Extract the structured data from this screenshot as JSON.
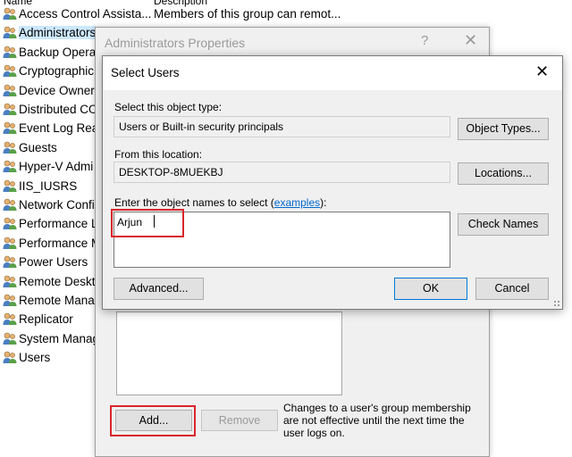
{
  "list": {
    "header_name": "Name",
    "header_desc": "Description",
    "groups": [
      {
        "name": "Access Control Assista...",
        "desc": "Members of this group can remot..."
      },
      {
        "name": "Administrators",
        "desc": ""
      },
      {
        "name": "Backup Operat",
        "desc": ""
      },
      {
        "name": "Cryptographic",
        "desc": ""
      },
      {
        "name": "Device Owners",
        "desc": ""
      },
      {
        "name": "Distributed CO",
        "desc": ""
      },
      {
        "name": "Event Log Rea",
        "desc": ""
      },
      {
        "name": "Guests",
        "desc": ""
      },
      {
        "name": "Hyper-V Admi",
        "desc": ""
      },
      {
        "name": "IIS_IUSRS",
        "desc": ""
      },
      {
        "name": "Network Confi",
        "desc": ""
      },
      {
        "name": "Performance Lo",
        "desc": ""
      },
      {
        "name": "Performance M",
        "desc": ""
      },
      {
        "name": "Power Users",
        "desc": ""
      },
      {
        "name": "Remote Deskto",
        "desc": ""
      },
      {
        "name": "Remote Manag",
        "desc": ""
      },
      {
        "name": "Replicator",
        "desc": ""
      },
      {
        "name": "System Manag",
        "desc": ""
      },
      {
        "name": "Users",
        "desc": ""
      }
    ]
  },
  "props_dialog": {
    "title": "Administrators Properties",
    "help": "?",
    "close": "✕",
    "add_label": "Add...",
    "remove_label": "Remove",
    "note": "Changes to a user's group membership are not effective until the next time the user logs on."
  },
  "select_dialog": {
    "title": "Select Users",
    "close": "✕",
    "object_type_label": "Select this object type:",
    "object_type_value": "Users or Built-in security principals",
    "object_types_button": "Object Types...",
    "location_label": "From this location:",
    "location_value": "DESKTOP-8MUEKBJ",
    "locations_button": "Locations...",
    "names_label_prefix": "Enter the object names to select (",
    "names_label_link": "examples",
    "names_label_suffix": "):",
    "names_value": "Arjun",
    "check_names_button": "Check Names",
    "advanced_button": "Advanced...",
    "ok_button": "OK",
    "cancel_button": "Cancel"
  },
  "colors": {
    "highlight_outline": "#d9262b",
    "link": "#0066cc",
    "selection": "#cce8ff"
  }
}
